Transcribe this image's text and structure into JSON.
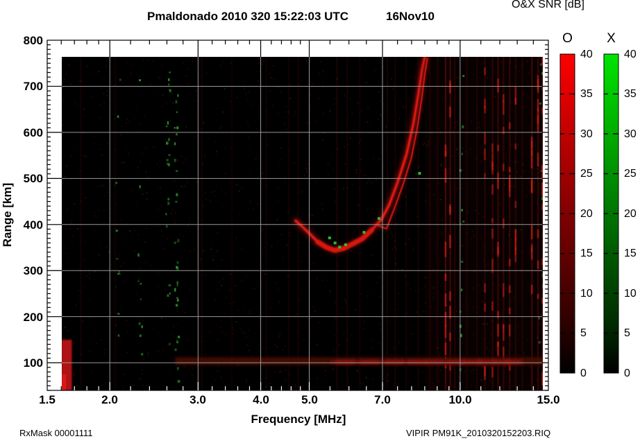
{
  "chart_data": {
    "type": "heatmap",
    "title": "Pmaldonado 2010 320 15:22:03 UTC",
    "date_label": "16Nov10",
    "colorbar_title": "O&X SNR [dB]",
    "xlabel": "Frequency [MHz]",
    "ylabel": "Range [km]",
    "x_scale": "log",
    "xlim": [
      1.5,
      15.0
    ],
    "ylim": [
      40,
      800
    ],
    "x_ticks": [
      1.5,
      2.0,
      3.0,
      4.0,
      5.0,
      7.0,
      10.0,
      15.0
    ],
    "x_minor_ticks": [
      1.6,
      1.7,
      1.8,
      1.9,
      2.2,
      2.4,
      2.6,
      2.8,
      3.2,
      3.4,
      3.6,
      3.8,
      4.2,
      4.4,
      4.6,
      4.8,
      5.5,
      6.0,
      6.5,
      7.5,
      8.0,
      8.5,
      9.0,
      9.5,
      11.0,
      12.0,
      13.0,
      14.0
    ],
    "y_ticks": [
      100,
      200,
      300,
      400,
      500,
      600,
      700,
      800
    ],
    "y_minor_step": 10,
    "grid": true,
    "grid_color": "#999999",
    "plot_background": "#000000",
    "colorbars": [
      {
        "label": "O",
        "units": "dB",
        "min": 0,
        "max": 40,
        "tick_step": 5,
        "label_step": 5,
        "color_scale": [
          "#000000",
          "#ff0000"
        ]
      },
      {
        "label": "X",
        "units": "dB",
        "min": 0,
        "max": 40,
        "tick_step": 5,
        "label_step": 5,
        "color_scale": [
          "#000000",
          "#00e400"
        ]
      }
    ],
    "series": [
      {
        "name": "O-mode F-layer echo trace",
        "color": "#e21912",
        "points_f_mhz_range_km": [
          [
            4.7,
            408
          ],
          [
            4.88,
            392
          ],
          [
            5.02,
            379
          ],
          [
            5.2,
            362
          ],
          [
            5.42,
            350
          ],
          [
            5.62,
            344
          ],
          [
            5.85,
            348
          ],
          [
            6.08,
            357
          ],
          [
            6.38,
            369
          ],
          [
            6.66,
            388
          ],
          [
            6.96,
            410
          ],
          [
            7.22,
            443
          ],
          [
            7.5,
            491
          ],
          [
            7.82,
            553
          ],
          [
            8.07,
            619
          ],
          [
            8.26,
            684
          ],
          [
            8.4,
            737
          ],
          [
            8.5,
            762
          ]
        ]
      },
      {
        "name": "X-mode F-layer echo trace",
        "color": "#c41410",
        "points_f_mhz_range_km": [
          [
            6.85,
            398
          ],
          [
            7.13,
            391
          ],
          [
            7.4,
            436
          ],
          [
            7.7,
            488
          ],
          [
            7.99,
            544
          ],
          [
            8.21,
            609
          ],
          [
            8.38,
            672
          ],
          [
            8.5,
            725
          ],
          [
            8.6,
            760
          ]
        ]
      },
      {
        "name": "X-mode strong echo points",
        "color": "#2ec22e",
        "points_f_mhz_range_km": [
          [
            5.49,
            371
          ],
          [
            5.63,
            360
          ],
          [
            5.75,
            351
          ],
          [
            5.91,
            356
          ],
          [
            6.43,
            383
          ],
          [
            6.89,
            413
          ],
          [
            8.3,
            511
          ]
        ]
      }
    ],
    "features": {
      "e_region_band": {
        "note": "diffuse horizontal echo band near 100 km",
        "freq_mhz": [
          2.7,
          14.8
        ],
        "range_km": [
          95,
          112
        ],
        "color": "#4a0a06",
        "bright_blobs_mhz": [
          5.9,
          6.6,
          7.4,
          8.2,
          8.9,
          9.8,
          10.6,
          11.3,
          12.1,
          12.8
        ]
      },
      "tx_artifact": {
        "note": "bright transmitter streak at low frequency",
        "freq_mhz": [
          1.6,
          1.68
        ],
        "range_km": [
          40,
          150
        ],
        "color": "#c21212"
      },
      "rfi_stripes": [
        {
          "f": 1.75,
          "a": 0.1
        },
        {
          "f": 2.05,
          "a": 0.08
        },
        {
          "f": 3.05,
          "a": 0.1
        },
        {
          "f": 3.5,
          "a": 0.07
        },
        {
          "f": 4.1,
          "a": 0.08
        },
        {
          "f": 4.55,
          "a": 0.08
        },
        {
          "f": 4.75,
          "a": 0.1
        },
        {
          "f": 5.0,
          "a": 0.09
        },
        {
          "f": 5.68,
          "a": 0.14
        },
        {
          "f": 5.95,
          "a": 0.12
        },
        {
          "f": 6.3,
          "a": 0.08
        },
        {
          "f": 7.15,
          "a": 0.12
        },
        {
          "f": 7.42,
          "a": 0.12
        },
        {
          "f": 7.8,
          "a": 0.1
        },
        {
          "f": 8.25,
          "a": 0.1
        },
        {
          "f": 8.7,
          "a": 0.12
        },
        {
          "f": 9.0,
          "a": 0.12
        },
        {
          "f": 9.35,
          "a": 0.35
        },
        {
          "f": 9.55,
          "a": 0.3
        },
        {
          "f": 9.75,
          "a": 0.15
        },
        {
          "f": 10.3,
          "a": 0.12
        },
        {
          "f": 10.8,
          "a": 0.12
        },
        {
          "f": 11.2,
          "a": 0.18
        },
        {
          "f": 11.6,
          "a": 0.2
        },
        {
          "f": 11.9,
          "a": 0.25
        },
        {
          "f": 12.2,
          "a": 0.22
        },
        {
          "f": 12.55,
          "a": 0.25
        },
        {
          "f": 12.9,
          "a": 0.18
        },
        {
          "f": 13.3,
          "a": 0.15
        },
        {
          "f": 13.9,
          "a": 0.3
        },
        {
          "f": 14.3,
          "a": 0.25
        },
        {
          "f": 14.6,
          "a": 0.3
        }
      ],
      "green_speckle_columns": [
        {
          "f": 2.08,
          "n": 10
        },
        {
          "f": 2.3,
          "n": 10
        },
        {
          "f": 2.62,
          "n": 22
        },
        {
          "f": 2.72,
          "n": 30
        },
        {
          "f": 10.1,
          "n": 14
        },
        {
          "f": 14.5,
          "n": 10
        }
      ]
    }
  },
  "footer": {
    "left": "RxMask 00001111",
    "right": "VIPIR  PM91K_2010320152203.RIQ"
  }
}
